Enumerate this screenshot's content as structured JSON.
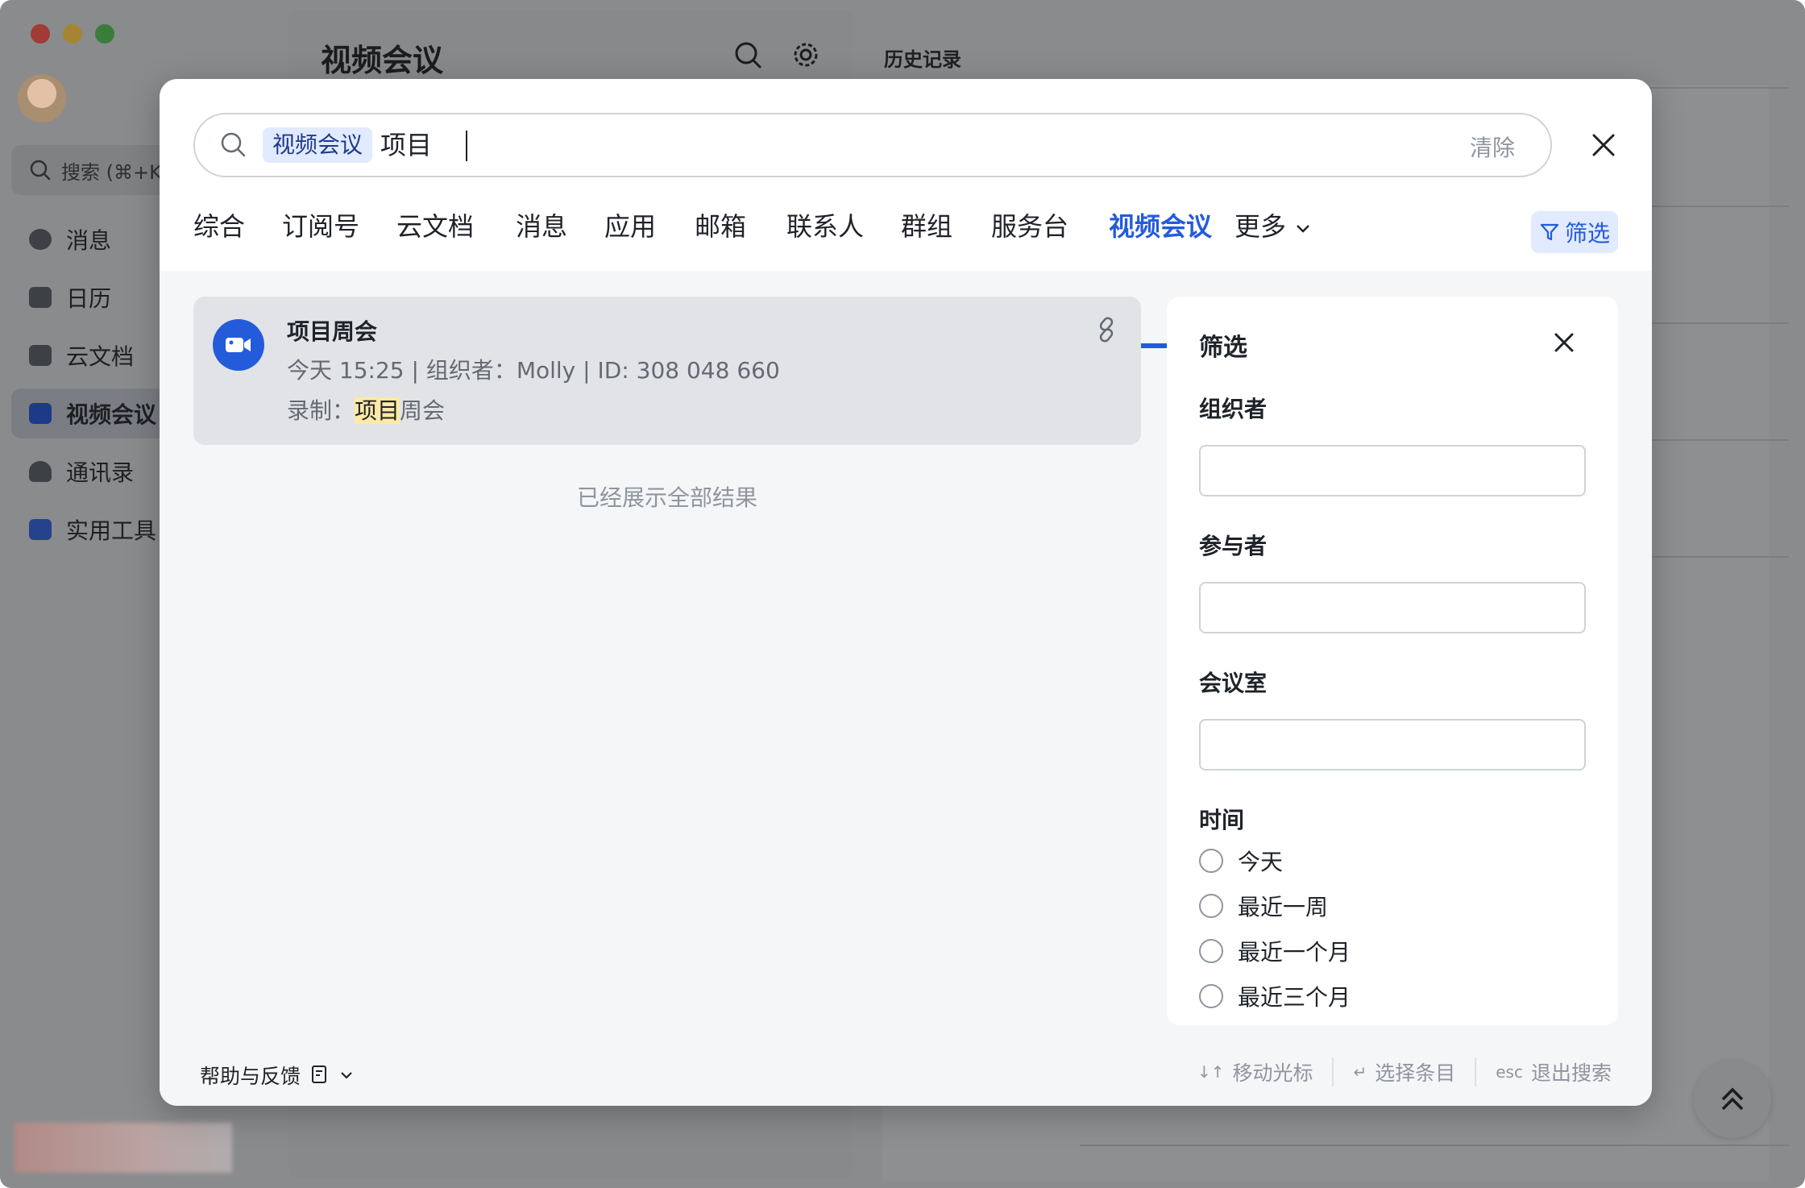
{
  "app": {
    "search_placeholder": "搜索 (⌘+K)",
    "nav": [
      {
        "label": "消息",
        "icon": "message-icon"
      },
      {
        "label": "日历",
        "icon": "calendar-icon"
      },
      {
        "label": "云文档",
        "icon": "docs-icon"
      },
      {
        "label": "视频会议",
        "icon": "video-meeting-icon"
      },
      {
        "label": "通讯录",
        "icon": "contacts-icon"
      },
      {
        "label": "实用工具",
        "icon": "tools-icon"
      }
    ],
    "main_title": "视频会议",
    "history_link": "历史记录"
  },
  "search": {
    "scope_tag": "视频会议",
    "query": "项目",
    "clear_label": "清除"
  },
  "tabs": [
    "综合",
    "订阅号",
    "云文档",
    "消息",
    "应用",
    "邮箱",
    "联系人",
    "群组",
    "服务台",
    "视频会议",
    "更多"
  ],
  "active_tab": "视频会议",
  "filter_button": "筛选",
  "result": {
    "title": "项目周会",
    "meta": "今天 15:25 | 组织者：Molly | ID: 308 048 660",
    "record_prefix": "录制：",
    "record_highlight": "项目",
    "record_rest": "周会"
  },
  "all_shown": "已经展示全部结果",
  "filter_panel": {
    "title": "筛选",
    "organizer_label": "组织者",
    "participant_label": "参与者",
    "room_label": "会议室",
    "time_label": "时间",
    "time_options": [
      "今天",
      "最近一周",
      "最近一个月",
      "最近三个月"
    ]
  },
  "footer": {
    "help": "帮助与反馈",
    "move_cursor": "移动光标",
    "select_item": "选择条目",
    "esc_key": "esc",
    "exit_search": "退出搜索"
  },
  "colors": {
    "accent": "#245bdb",
    "tag_bg": "#e1eaff",
    "highlight": "#ffe9a6"
  }
}
